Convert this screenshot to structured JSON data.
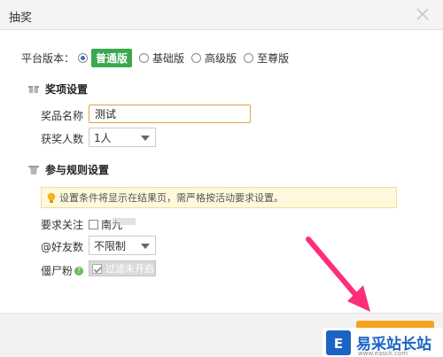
{
  "dialog": {
    "title": "抽奖"
  },
  "platform": {
    "label": "平台版本：",
    "options": [
      {
        "label": "普通版",
        "selected": true
      },
      {
        "label": "基础版",
        "selected": false
      },
      {
        "label": "高级版",
        "selected": false
      },
      {
        "label": "至尊版",
        "selected": false
      }
    ]
  },
  "prize_section": {
    "heading": "奖项设置",
    "name_label": "奖品名称",
    "name_value": "测试",
    "count_label": "获奖人数",
    "count_value": "1人"
  },
  "rules_section": {
    "heading": "参与规则设置",
    "notice": "设置条件将显示在结果页，需严格按活动要求设置。",
    "follow_label": "要求关注",
    "follow_option": "南九",
    "friends_label": "@好友数",
    "friends_value": "不限制",
    "zombie_label": "僵尸粉",
    "zombie_help": "?",
    "zombie_filter": "过滤未开启"
  },
  "footer": {
    "confirm_label": ""
  },
  "watermark": {
    "name": "易采站长站",
    "url": "www.easck.com"
  },
  "colors": {
    "accent_green": "#3aa84f",
    "confirm_orange": "#f6a31c",
    "annotation_pink": "#ff2d7a"
  }
}
